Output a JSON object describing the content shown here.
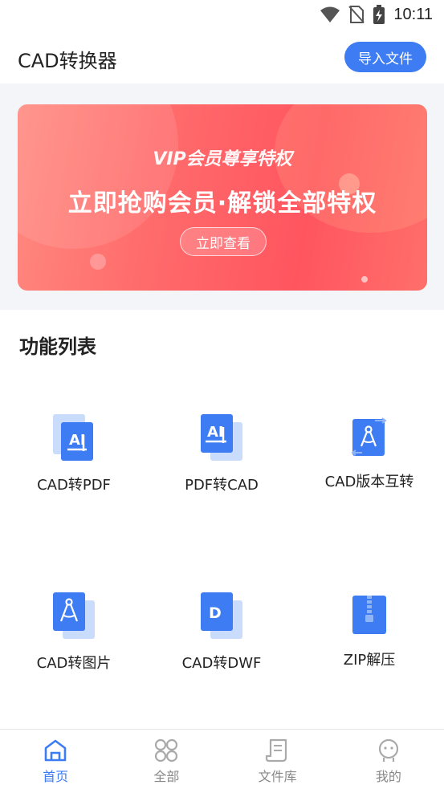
{
  "status_bar": {
    "time": "10:11"
  },
  "header": {
    "title": "CAD转换器",
    "import_button": "导入文件"
  },
  "banner": {
    "subtitle": "VIP会员尊享特权",
    "headline": "立即抢购会员·解锁全部特权",
    "button": "立即查看"
  },
  "section": {
    "title": "功能列表"
  },
  "features": [
    {
      "label": "CAD转PDF",
      "icon": "ai-document-icon"
    },
    {
      "label": "PDF转CAD",
      "icon": "ai-document-icon"
    },
    {
      "label": "CAD版本互转",
      "icon": "compass-convert-icon"
    },
    {
      "label": "CAD转图片",
      "icon": "compass-document-icon"
    },
    {
      "label": "CAD转DWF",
      "icon": "d-document-icon"
    },
    {
      "label": "ZIP解压",
      "icon": "zip-file-icon"
    }
  ],
  "bottom_nav": [
    {
      "label": "首页",
      "icon": "home-icon",
      "active": true
    },
    {
      "label": "全部",
      "icon": "grid-icon",
      "active": false
    },
    {
      "label": "文件库",
      "icon": "file-library-icon",
      "active": false
    },
    {
      "label": "我的",
      "icon": "profile-icon",
      "active": false
    }
  ],
  "colors": {
    "accent": "#3d7cf2",
    "banner": "#ff5f63",
    "icon_light": "#c9dcfb"
  }
}
